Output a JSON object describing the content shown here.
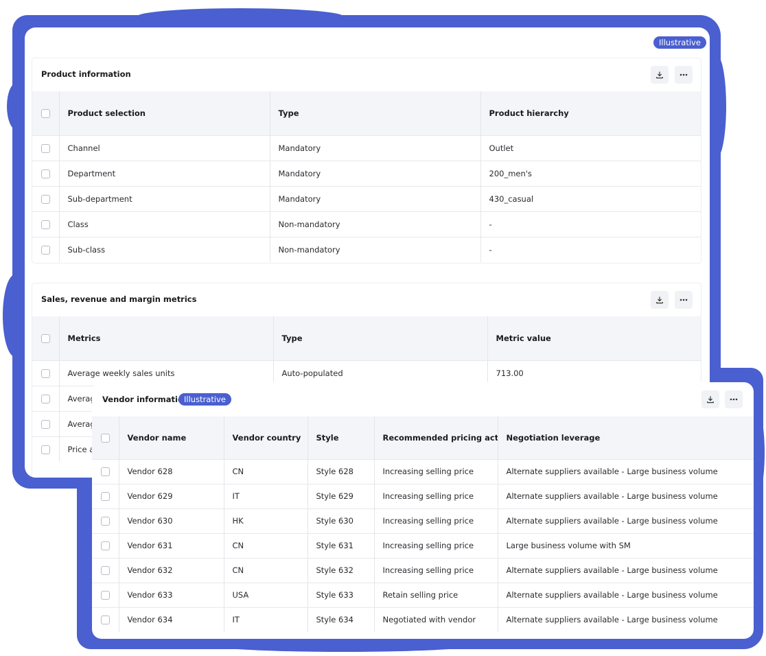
{
  "badge_label": "Illustrative",
  "product_info": {
    "title": "Product information",
    "columns": [
      "Product selection",
      "Type",
      "Product hierarchy"
    ],
    "rows": [
      [
        "Channel",
        "Mandatory",
        "Outlet"
      ],
      [
        "Department",
        "Mandatory",
        "200_men's"
      ],
      [
        "Sub-department",
        "Mandatory",
        "430_casual"
      ],
      [
        "Class",
        "Non-mandatory",
        "-"
      ],
      [
        "Sub-class",
        "Non-mandatory",
        "-"
      ]
    ]
  },
  "metrics": {
    "title": "Sales, revenue and margin metrics",
    "columns": [
      "Metrics",
      "Type",
      "Metric value"
    ],
    "rows": [
      [
        "Average weekly sales units",
        "Auto-populated",
        "713.00"
      ],
      [
        "Averag",
        "",
        ""
      ],
      [
        "Averag",
        "",
        ""
      ],
      [
        "Price a",
        "",
        ""
      ]
    ]
  },
  "vendor_info": {
    "title": "Vendor information",
    "columns": [
      "Vendor name",
      "Vendor country",
      "Style",
      "Recommended pricing action",
      "Negotiation leverage"
    ],
    "rows": [
      [
        "Vendor 628",
        "CN",
        "Style 628",
        "Increasing selling price",
        "Alternate suppliers available - Large business volume"
      ],
      [
        "Vendor 629",
        "IT",
        "Style 629",
        "Increasing selling price",
        "Alternate suppliers available - Large business volume"
      ],
      [
        "Vendor 630",
        "HK",
        "Style 630",
        "Increasing selling price",
        "Alternate suppliers available - Large business volume"
      ],
      [
        "Vendor 631",
        "CN",
        "Style 631",
        "Increasing selling price",
        "Large business volume with SM"
      ],
      [
        "Vendor 632",
        "CN",
        "Style 632",
        "Increasing selling price",
        "Alternate suppliers available - Large business volume"
      ],
      [
        "Vendor 633",
        "USA",
        "Style 633",
        "Retain selling price",
        "Alternate suppliers available - Large business volume"
      ],
      [
        "Vendor 634",
        "IT",
        "Style 634",
        "Negotiated with vendor",
        "Alternate suppliers available - Large business volume"
      ]
    ]
  },
  "icons": {
    "download": "download-icon",
    "more": "more-horizontal-icon"
  },
  "colors": {
    "accent": "#4a5fd0",
    "header_bg": "#f4f5f8",
    "border": "#e3e5ea"
  }
}
